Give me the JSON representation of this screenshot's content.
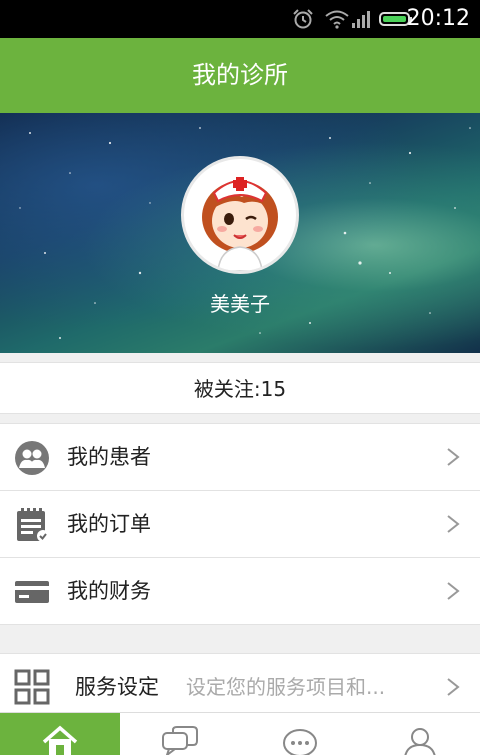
{
  "status_bar": {
    "time": "20:12",
    "icons": [
      "alarm-icon",
      "wifi-icon",
      "signal-icon",
      "battery-icon"
    ]
  },
  "header": {
    "title": "我的诊所"
  },
  "profile": {
    "name": "美美子",
    "avatar": "nurse-avatar"
  },
  "followers": {
    "text": "被关注:15"
  },
  "menu": {
    "items": [
      {
        "label": "我的患者",
        "icon": "patients-icon"
      },
      {
        "label": "我的订单",
        "icon": "order-icon"
      },
      {
        "label": "我的财务",
        "icon": "wallet-card-icon"
      }
    ]
  },
  "service": {
    "label": "服务设定",
    "description": "设定您的服务项目和...",
    "icon": "grid-icon"
  },
  "tabs": [
    {
      "name": "home",
      "icon": "home-icon",
      "active": true
    },
    {
      "name": "chat",
      "icon": "chat-icon",
      "active": false
    },
    {
      "name": "message",
      "icon": "message-icon",
      "active": false
    },
    {
      "name": "profile",
      "icon": "user-icon",
      "active": false
    }
  ],
  "colors": {
    "brand": "#6cb33e"
  }
}
